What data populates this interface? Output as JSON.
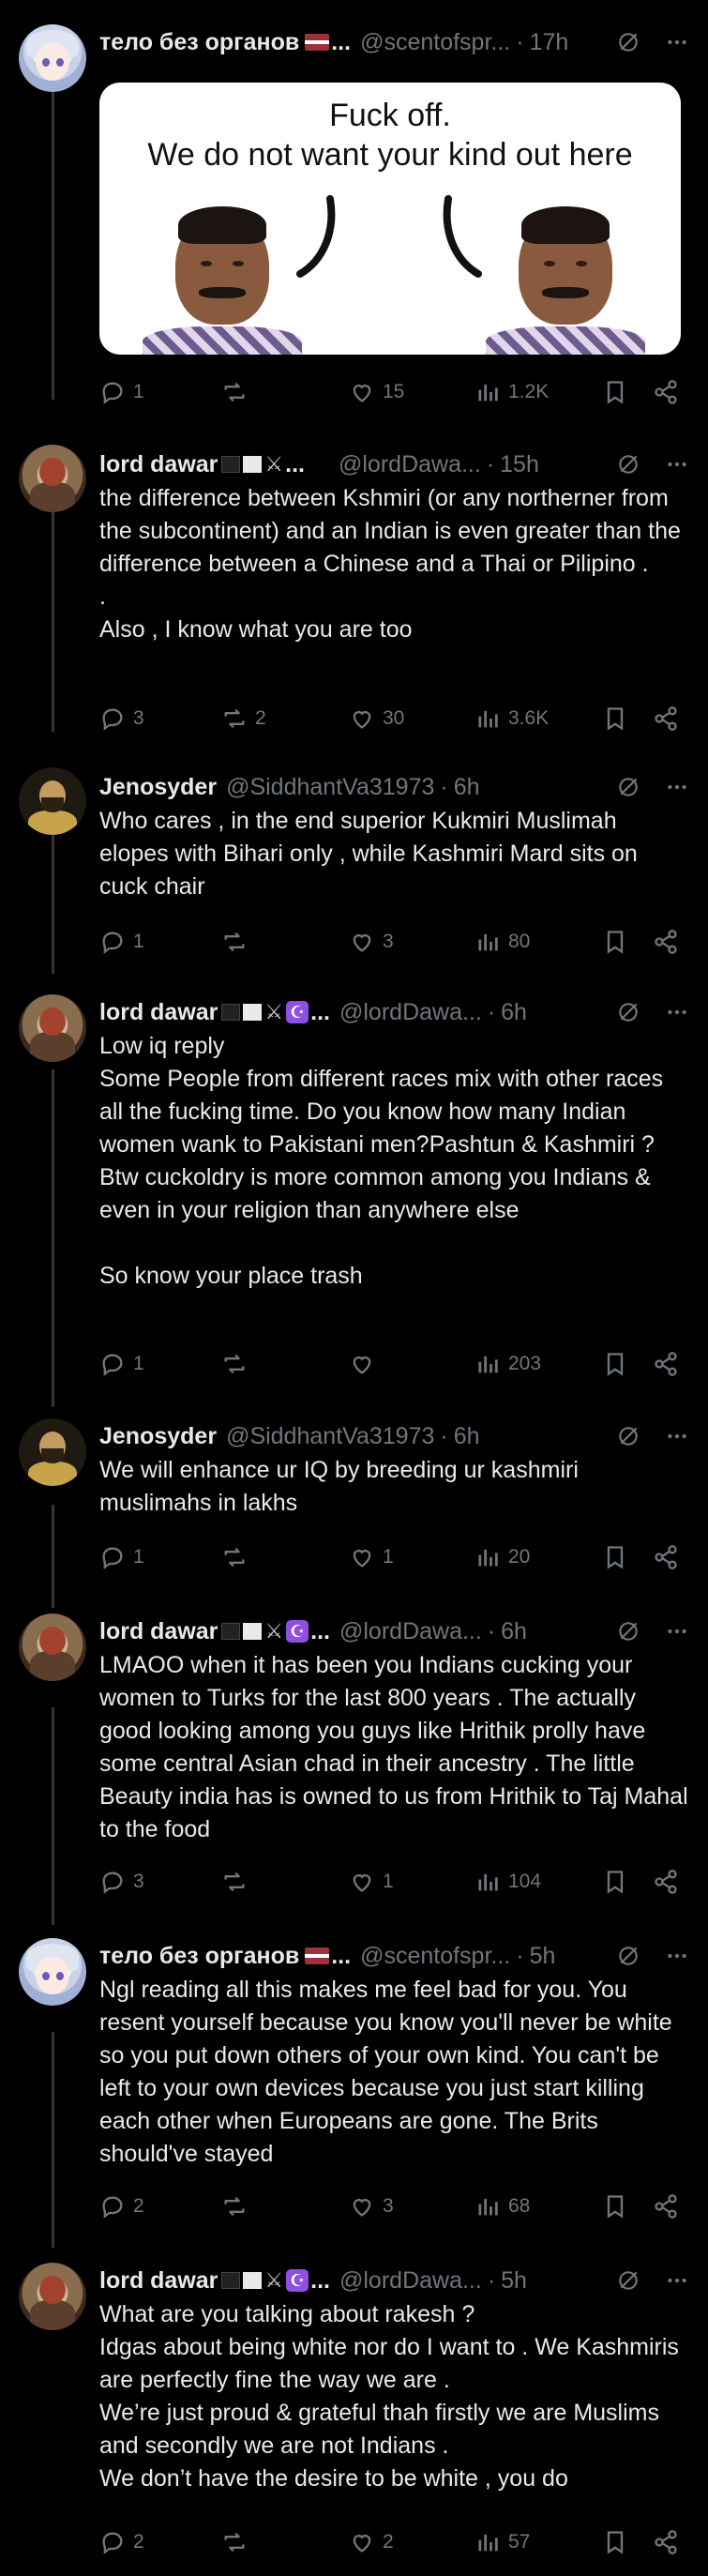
{
  "posts": [
    {
      "name": "тело без органов",
      "handle": "@scentofspr...",
      "time": "17h",
      "text": "",
      "media": {
        "line1": "Fuck off.",
        "line2": "We do not want your kind out here"
      },
      "stats": {
        "replies": "1",
        "reposts": "",
        "likes": "15",
        "views": "1.2K"
      }
    },
    {
      "name": "lord dawar",
      "handle": "@lordDawa...",
      "time": "15h",
      "text": "the difference between Kshmiri (or any northerner from the subcontinent) and an Indian is even greater than the difference between a Chinese and a Thai or Pilipino .\n.\nAlso , I know what you are too",
      "stats": {
        "replies": "3",
        "reposts": "2",
        "likes": "30",
        "views": "3.6K"
      }
    },
    {
      "name": "Jenosyder",
      "handle": "@SiddhantVa31973",
      "time": "6h",
      "text": "Who cares , in the end superior Kukmiri Muslimah elopes with Bihari only , while Kashmiri Mard sits on cuck chair",
      "stats": {
        "replies": "1",
        "reposts": "",
        "likes": "3",
        "views": "80"
      }
    },
    {
      "name": "lord dawar",
      "handle": "@lordDawa...",
      "time": "6h",
      "text": "Low iq reply\nSome People from different races mix with other races all the fucking time. Do you know how many Indian women wank to Pakistani men?Pashtun & Kashmiri ?Btw cuckoldry is more common among you Indians & even in your religion than anywhere else\n\nSo know your place trash",
      "stats": {
        "replies": "1",
        "reposts": "",
        "likes": "",
        "views": "203"
      }
    },
    {
      "name": "Jenosyder",
      "handle": "@SiddhantVa31973",
      "time": "6h",
      "text": "We will enhance ur IQ by breeding ur kashmiri muslimahs in lakhs",
      "stats": {
        "replies": "1",
        "reposts": "",
        "likes": "1",
        "views": "20"
      }
    },
    {
      "name": "lord dawar",
      "handle": "@lordDawa...",
      "time": "6h",
      "text": "LMAOO when it has been you Indians cucking your women to Turks for the last 800 years . The actually good looking among you guys like Hrithik prolly have some central Asian chad in their ancestry . The little Beauty india has is owned to us from Hrithik to Taj Mahal to the food",
      "stats": {
        "replies": "3",
        "reposts": "",
        "likes": "1",
        "views": "104"
      }
    },
    {
      "name": "тело без органов",
      "handle": "@scentofspr...",
      "time": "5h",
      "text": "Ngl reading all this makes me feel bad for you. You resent yourself because you know you'll never be white so you put down others of your own kind. You can't be left to your own devices because you just start killing each other when Europeans are gone. The Brits should've stayed",
      "stats": {
        "replies": "2",
        "reposts": "",
        "likes": "3",
        "views": "68"
      }
    },
    {
      "name": "lord dawar",
      "handle": "@lordDawa...",
      "time": "5h",
      "text": "What are you talking about rakesh ?\nIdgas about being white nor do I want to . We Kashmiris are perfectly fine the way we are .\nWe’re just proud & grateful thah firstly we are Muslims and secondly we are not Indians .\nWe don’t have the desire to be white , you do",
      "stats": {
        "replies": "2",
        "reposts": "",
        "likes": "2",
        "views": "57"
      }
    }
  ],
  "ui": {
    "dot": "·",
    "ellipsis": "..."
  }
}
